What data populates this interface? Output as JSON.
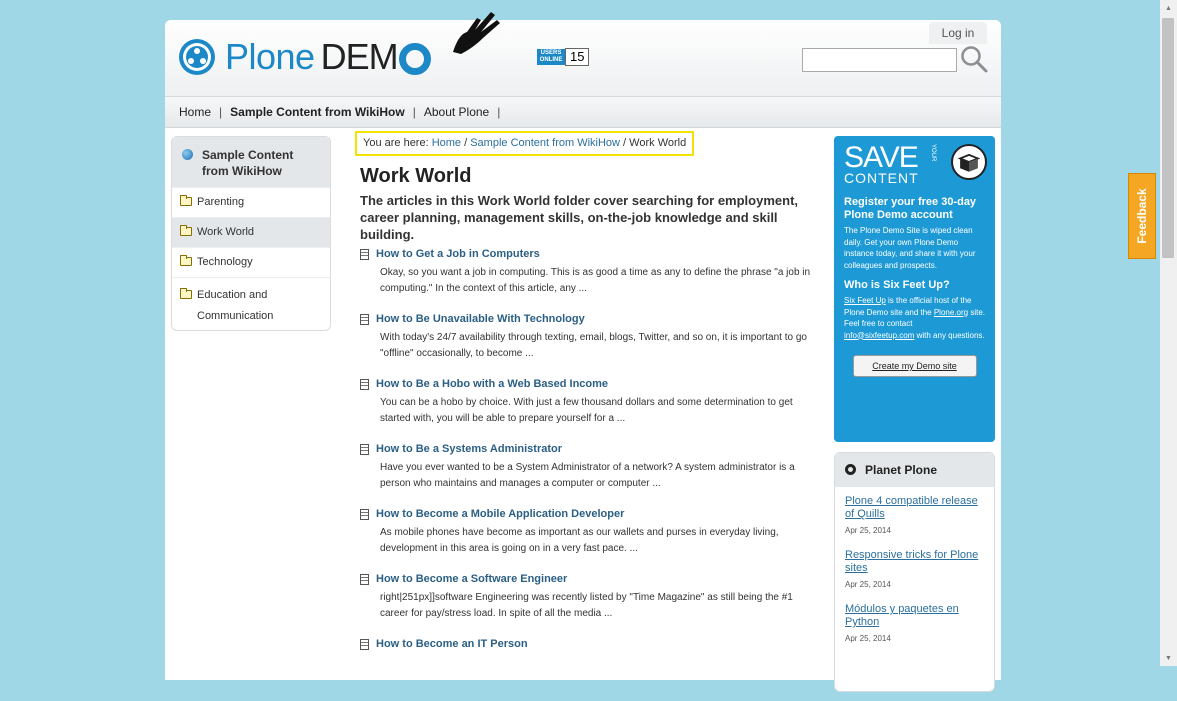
{
  "site": {
    "logo_text": "Plone",
    "logo_demo": "DEM",
    "users_online_label": "USERS ONLINE",
    "users_online_count": "15",
    "login_label": "Log in",
    "search_placeholder": ""
  },
  "nav": {
    "items": [
      "Home",
      "Sample Content from WikiHow",
      "About Plone"
    ]
  },
  "sidebar": {
    "header": "Sample Content from WikiHow",
    "items": [
      "Parenting",
      "Work World",
      "Technology",
      "Education and Communication"
    ]
  },
  "breadcrumb": {
    "prefix": "You are here: ",
    "home": "Home",
    "sep": " / ",
    "section": "Sample Content from WikiHow",
    "current": "Work World"
  },
  "main": {
    "title": "Work World",
    "description": "The articles in this Work World folder cover searching for employment, career planning, management skills, on-the-job knowledge and skill building.",
    "items": [
      {
        "title": "How to Get a Job in Computers",
        "desc": "Okay, so you want a job in computing. This is as good a time as any to define the phrase \"a job in computing.\" In the context of this article, any ..."
      },
      {
        "title": "How to Be Unavailable With Technology",
        "desc": "With today's 24/7 availability through texting, email, blogs, Twitter, and so on, it is important to go \"offline\" occasionally, to become ..."
      },
      {
        "title": "How to Be a Hobo with a Web Based Income",
        "desc": "You can be a hobo by choice. With just a few thousand dollars and some determination to get started with, you will be able to prepare yourself for a ..."
      },
      {
        "title": "How to Be a Systems Administrator",
        "desc": "Have you ever wanted to be a System Administrator of a network? A system administrator is a person who maintains and manages a computer or computer ..."
      },
      {
        "title": "How to Become a Mobile Application Developer",
        "desc": "As mobile phones have become as important as our wallets and purses in everyday living, development in this area is going on in a very fast pace. ..."
      },
      {
        "title": "How to Become a Software Engineer",
        "desc": "right|251px]]software Engineering was recently listed by \"Time Magazine\" as still being the #1 career for pay/stress load. In spite of all the media ..."
      },
      {
        "title": "How to Become an IT Person",
        "desc": ""
      }
    ]
  },
  "promo": {
    "big": "SAVE",
    "your": "YOUR",
    "sub": "CONTENT",
    "h1": "Register your free 30-day Plone Demo account",
    "p1": "The Plone Demo Site is wiped clean daily. Get your own Plone Demo instance today, and share it with your colleagues and prospects.",
    "h2": "Who is Six Feet Up?",
    "p2_link1": "Six Feet Up",
    "p2_a": " is the official host of the Plone Demo site and the ",
    "p2_link2": "Plone.org",
    "p2_b": " site. Feel free to contact ",
    "p2_link3": "info@sixfeetup.com",
    "p2_c": " with any questions.",
    "button": "Create my Demo site"
  },
  "planet": {
    "header": "Planet Plone",
    "items": [
      {
        "title": "Plone 4 compatible release of Quills",
        "date": "Apr 25, 2014"
      },
      {
        "title": "Responsive tricks for Plone sites",
        "date": "Apr 25, 2014"
      },
      {
        "title": "Módulos y paquetes en Python",
        "date": "Apr 25, 2014"
      }
    ]
  },
  "feedback": {
    "label": "Feedback"
  },
  "colors": {
    "accent": "#1d9ad6",
    "link": "#2b6f9e",
    "feedback": "#f5a623",
    "highlight": "#f2e400"
  }
}
